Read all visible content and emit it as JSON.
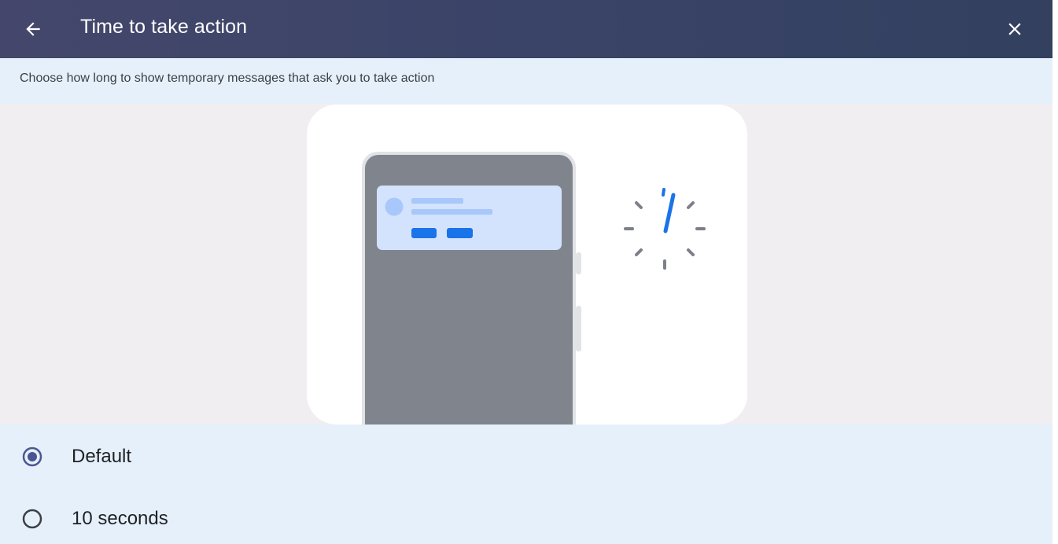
{
  "header": {
    "title": "Time to take action",
    "back_icon": "arrow-back-icon",
    "close_icon": "close-icon"
  },
  "description": "Choose how long to show temporary messages that ask you to take action",
  "illustration": {
    "phone_icon": "phone-notification-icon",
    "clock_icon": "timer-dial-icon"
  },
  "options": [
    {
      "label": "Default",
      "selected": true
    },
    {
      "label": "10 seconds",
      "selected": false
    }
  ],
  "colors": {
    "header_bg": "#3a4468",
    "row_bg": "#e6f0fb",
    "illustration_bg": "#f1eef2",
    "accent": "#1a73e8",
    "radio_selected": "#4a5693"
  }
}
